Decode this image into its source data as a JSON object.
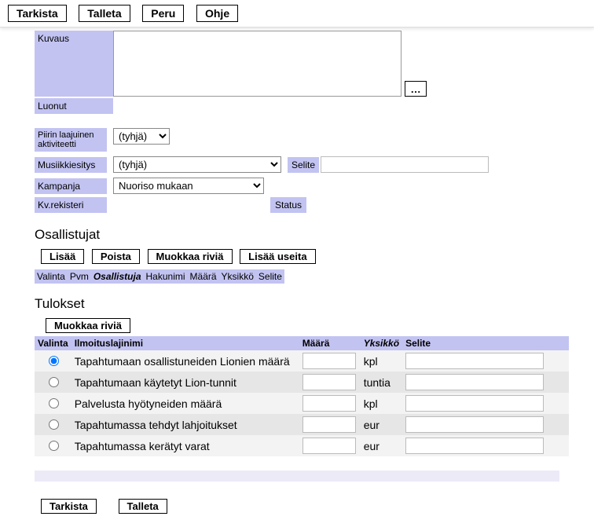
{
  "toolbar": {
    "tarkista": "Tarkista",
    "talleta": "Talleta",
    "peru": "Peru",
    "ohje": "Ohje"
  },
  "labels": {
    "kuvaus": "Kuvaus",
    "luonut": "Luonut",
    "piirin": "Piirin laajuinen aktiviteetti",
    "musiikki": "Musiikkiesitys",
    "selite": "Selite",
    "kampanja": "Kampanja",
    "kvrek": "Kv.rekisteri",
    "status": "Status"
  },
  "fields": {
    "kuvaus_value": "",
    "piirin_value": "(tyhjä)",
    "musiikki_value": "(tyhjä)",
    "selite_value": "",
    "kampanja_value": "Nuoriso mukaan"
  },
  "osallistujat": {
    "heading": "Osallistujat",
    "buttons": {
      "lisaa": "Lisää",
      "poista": "Poista",
      "muokkaa": "Muokkaa riviä",
      "lisaa_useita": "Lisää useita"
    },
    "headers": [
      "Valinta",
      "Pvm",
      "Osallistuja",
      "Hakunimi",
      "Määrä",
      "Yksikkö",
      "Selite"
    ]
  },
  "tulokset": {
    "heading": "Tulokset",
    "muokkaa": "Muokkaa riviä",
    "headers": {
      "valinta": "Valinta",
      "ilmoitus": "Ilmoituslajinimi",
      "maara": "Määrä",
      "yksikko": "Yksikkö",
      "selite": "Selite"
    },
    "rows": [
      {
        "name": "Tapahtumaan osallistuneiden Lionien määrä",
        "unit": "kpl"
      },
      {
        "name": "Tapahtumaan käytetyt Lion-tunnit",
        "unit": "tuntia"
      },
      {
        "name": "Palvelusta hyötyneiden määrä",
        "unit": "kpl"
      },
      {
        "name": "Tapahtumassa tehdyt lahjoitukset",
        "unit": "eur"
      },
      {
        "name": "Tapahtumassa kerätyt varat",
        "unit": "eur"
      }
    ]
  },
  "footer": {
    "tarkista": "Tarkista",
    "talleta": "Talleta"
  }
}
